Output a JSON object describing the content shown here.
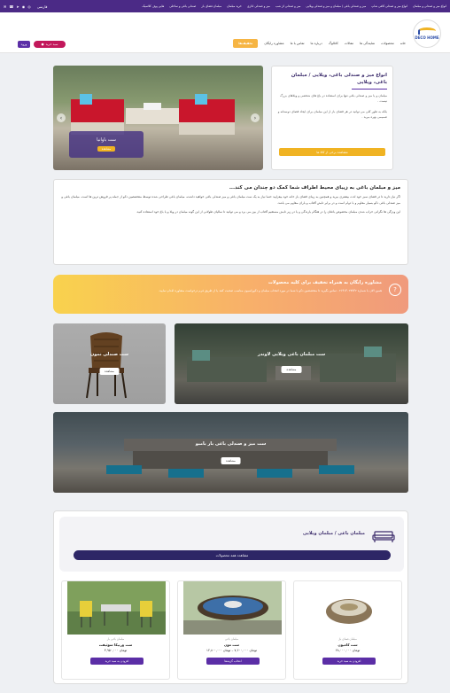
{
  "topbar": {
    "links": [
      "انواع میز و صندلی و مبلمان",
      "انواع میز و صندلی کافی شاپ",
      "میز و صندلی باغی / مبلمان و میز و صندلی ویلایی",
      "میز و صندلی لژ شب",
      "میز و صندلی اداری",
      "خرید مبلمان",
      "مبلمان فضای باز",
      "صندلی باغی و ساحلی",
      "هایی پوف کلاسیک"
    ],
    "lang": "فارسی",
    "icons": [
      "instagram-icon",
      "whatsapp-icon",
      "telegram-icon",
      "phone-icon",
      "email-icon"
    ]
  },
  "header": {
    "logo_text": "DECO HOME",
    "nav": [
      "خانه",
      "محصولات",
      "نمایندگی ها",
      "مقالات",
      "کاتالوگ",
      "درباره ما",
      "تماس با ما",
      "مشاوره رایگان"
    ],
    "offer": "تخفیف‌ها",
    "login": "ورود",
    "cart": "سبد خرید"
  },
  "hero": {
    "caption": "ست باوانیا",
    "caption_btn": "مشاهده",
    "prev": "‹",
    "next": "›",
    "title": "انواع میز و صندلی باغی، ویلایی / مبلمان باغی، ویلایی",
    "p1": "مبلمان و یا میز و صندلی باغی تنها برای استفاده در باغ های شخصی و ویلاهای بزرگ نیست .",
    "p2": "بلکه به طور کلی می توانید در هر فضای باز از این مبلمان برای ایجاد فضای دوستانه و صمیمی بهره ببرید .",
    "btn": "مشاهده برخی از کالا ها"
  },
  "description": {
    "title": "میز و مبلمان باغی به زیبای محیط اطراف شما کمک دو چندان می کند...",
    "p1": "اگر نیاز دارید تا در فضای سبز خود لذت بیشتری ببرید و همچنین به زیبای فضای باز خانه خود بیفزایید حتما نیاز به یک ست مبلمان باغی و میز صندلی باغی خواهید داشت، مبلمان باغی طراحی شده توسط متخصصین دکو از جمله پر فروش ترین ها است. مبلمان باغی و میز صندلی باغی دکو بسیار مقاوم و با دوام است و در برابر تابش آفتاب و باران مقاوم می باشد.",
    "p2": "این ویژگی ها نگرانی خراب شدن مبلمان مخصوص باغتان را در هنگام بارندگی و یا در زیر تابش مستقیم آفتاب از بین می برد و می توانید تا سالیان طولانی از این گونه مبلمان در ویلا و یا باغ خود استفاده کنید."
  },
  "consult": {
    "icon": "?",
    "title": "مشاوره رایگان به همراه تخفیف برای کلیه محصولات",
    "text": "همین الان با شماره ۰۲۱۹۱۳۰۲۷۷۳۲ تماس بگیرید تا متخصصین دکو با شما در مورد انتخاب مبلمان و دکوراسیون مناسب صحبت کنند یا از طریق فرم درخواست مشاوره اقدام نمایید."
  },
  "tiles": [
    {
      "title": "ست صندلی نمون",
      "btn": "مشاهده"
    },
    {
      "title": "ست مبلمان باغی ویلایی لاوندر",
      "btn": "مشاهده"
    },
    {
      "title": "ست میز و صندلی باغی بار بامبو",
      "btn": "مشاهده"
    }
  ],
  "products": {
    "title": "مبلمان باغی / مبلمان ویلایی",
    "all_btn": "مشاهده همه محصولات",
    "cards": [
      {
        "cat": "مبلمان باغی بار",
        "name": "ست ورنیکا سوئیفت",
        "price": "تومان ۳,۹۵۰,۰۰۰",
        "btn": "افزودن به سبد خرید"
      },
      {
        "cat": "مبلمان باغی",
        "name": "ست مون",
        "price": "تومان ۷,۶۰۰,۰۰۰ – تومان ۱۲,۸۰۰,۰۰۰",
        "btn": "انتخاب گزینه‌ها"
      },
      {
        "cat": "مبلمان فضای باز",
        "name": "ست کامیون",
        "price": "تومان ۲۸,۰۰۰,۰۰۰",
        "btn": "افزودن به سبد خرید"
      }
    ]
  }
}
